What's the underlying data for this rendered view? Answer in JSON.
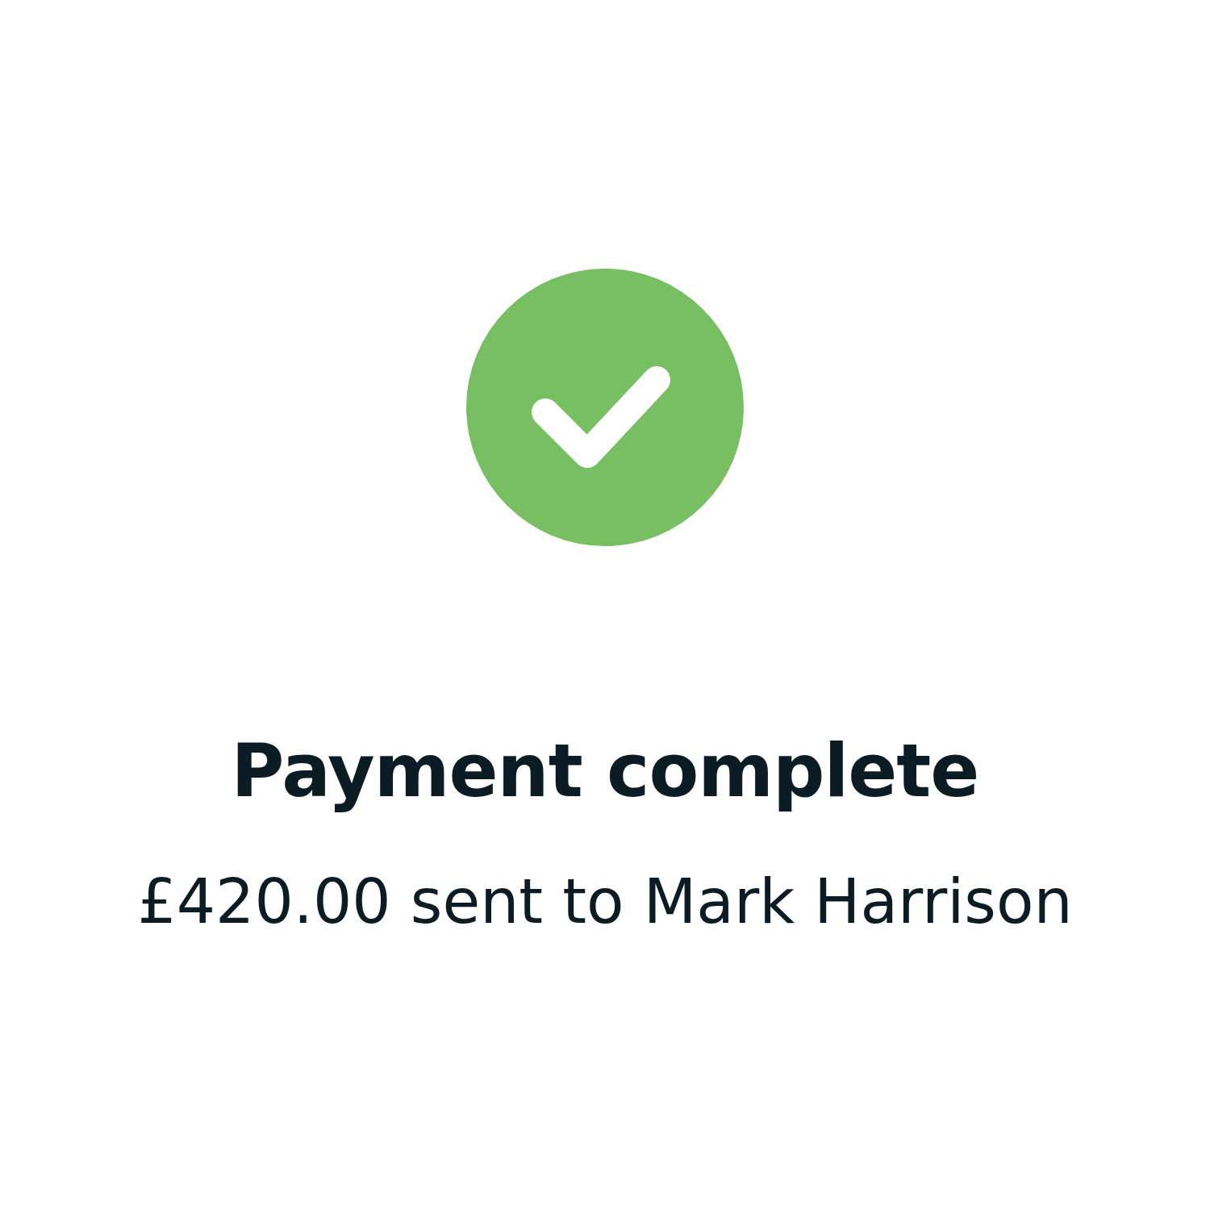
{
  "status": {
    "kind": "success"
  },
  "title": "Payment complete",
  "message": "£420.00 sent to Mark Harrison"
}
